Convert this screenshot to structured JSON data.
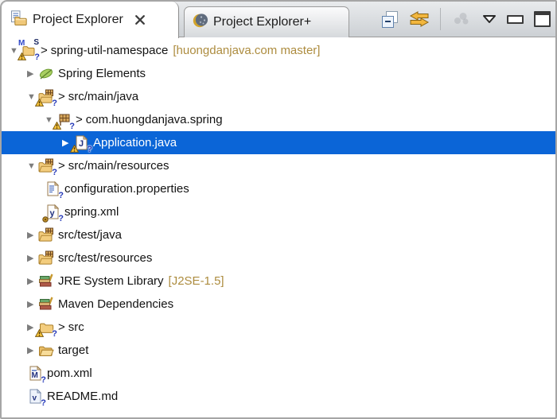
{
  "view": {
    "name": "Project Explorer view"
  },
  "tabs": [
    {
      "label": "Project Explorer",
      "icon": "project-explorer-icon",
      "active": true,
      "closable": true
    },
    {
      "label": "Project Explorer+",
      "icon": "project-explorer-plus-icon",
      "active": false,
      "closable": false
    }
  ],
  "toolbar": {
    "icons": [
      {
        "name": "collapse-all-icon",
        "enabled": true
      },
      {
        "name": "link-with-editor-icon",
        "enabled": true
      },
      {
        "name": "extra-actions-icon",
        "enabled": false
      },
      {
        "name": "view-menu-icon",
        "enabled": true
      },
      {
        "name": "minimize-icon",
        "enabled": true
      },
      {
        "name": "maximize-icon",
        "enabled": true
      }
    ]
  },
  "colors": {
    "selection_background": "#0b65d7",
    "decorator_text": "#ad8c3f",
    "tab_bar_gradient_top": "#e9ebed",
    "tab_bar_gradient_bottom": "#ccd0d4",
    "tree_text": "#121212",
    "selected_text": "#ffffff"
  },
  "tree": {
    "rows": [
      {
        "level": 0,
        "expand": "expanded",
        "icon": "maven-project",
        "overlays": [
          "maven",
          "spring-s",
          "warning",
          "question"
        ],
        "prefix": ">",
        "label": "spring-util-namespace",
        "suffix": "[huongdanjava.com master]",
        "selected": false
      },
      {
        "level": 1,
        "expand": "collapsed",
        "icon": "spring-leaf",
        "overlays": [],
        "label": "Spring Elements",
        "selected": false
      },
      {
        "level": 1,
        "expand": "expanded",
        "icon": "package-folder",
        "overlays": [
          "warning",
          "question"
        ],
        "prefix": ">",
        "label": "src/main/java",
        "selected": false
      },
      {
        "level": 2,
        "expand": "expanded",
        "icon": "package",
        "overlays": [
          "warning",
          "question"
        ],
        "prefix": ">",
        "label": "com.huongdanjava.spring",
        "selected": false
      },
      {
        "level": 3,
        "expand": "collapsed",
        "icon": "java-file",
        "overlays": [
          "warning",
          "question"
        ],
        "label": "Application.java",
        "selected": true
      },
      {
        "level": 1,
        "expand": "expanded",
        "icon": "package-folder",
        "overlays": [
          "question"
        ],
        "prefix": ">",
        "label": "src/main/resources",
        "selected": false
      },
      {
        "level": 2,
        "expand": "leaf",
        "icon": "properties-file",
        "overlays": [
          "question"
        ],
        "label": "configuration.properties",
        "selected": false
      },
      {
        "level": 2,
        "expand": "leaf",
        "icon": "spring-xml-file",
        "overlays": [
          "gear",
          "question"
        ],
        "label": "spring.xml",
        "selected": false
      },
      {
        "level": 1,
        "expand": "collapsed",
        "icon": "package-folder",
        "overlays": [],
        "label": "src/test/java",
        "selected": false
      },
      {
        "level": 1,
        "expand": "collapsed",
        "icon": "package-folder",
        "overlays": [],
        "label": "src/test/resources",
        "selected": false
      },
      {
        "level": 1,
        "expand": "collapsed",
        "icon": "library",
        "overlays": [],
        "label": "JRE System Library",
        "suffix": "[J2SE-1.5]",
        "selected": false
      },
      {
        "level": 1,
        "expand": "collapsed",
        "icon": "library",
        "overlays": [],
        "label": "Maven Dependencies",
        "selected": false
      },
      {
        "level": 1,
        "expand": "collapsed",
        "icon": "folder",
        "overlays": [
          "warning",
          "question"
        ],
        "prefix": ">",
        "label": "src",
        "selected": false
      },
      {
        "level": 1,
        "expand": "collapsed",
        "icon": "folder-open",
        "overlays": [],
        "label": "target",
        "selected": false
      },
      {
        "level": 1,
        "expand": "leaf",
        "icon": "pom-file",
        "overlays": [
          "question"
        ],
        "label": "pom.xml",
        "selected": false
      },
      {
        "level": 1,
        "expand": "leaf",
        "icon": "readme-file",
        "overlays": [
          "question"
        ],
        "label": "README.md",
        "selected": false
      }
    ]
  }
}
